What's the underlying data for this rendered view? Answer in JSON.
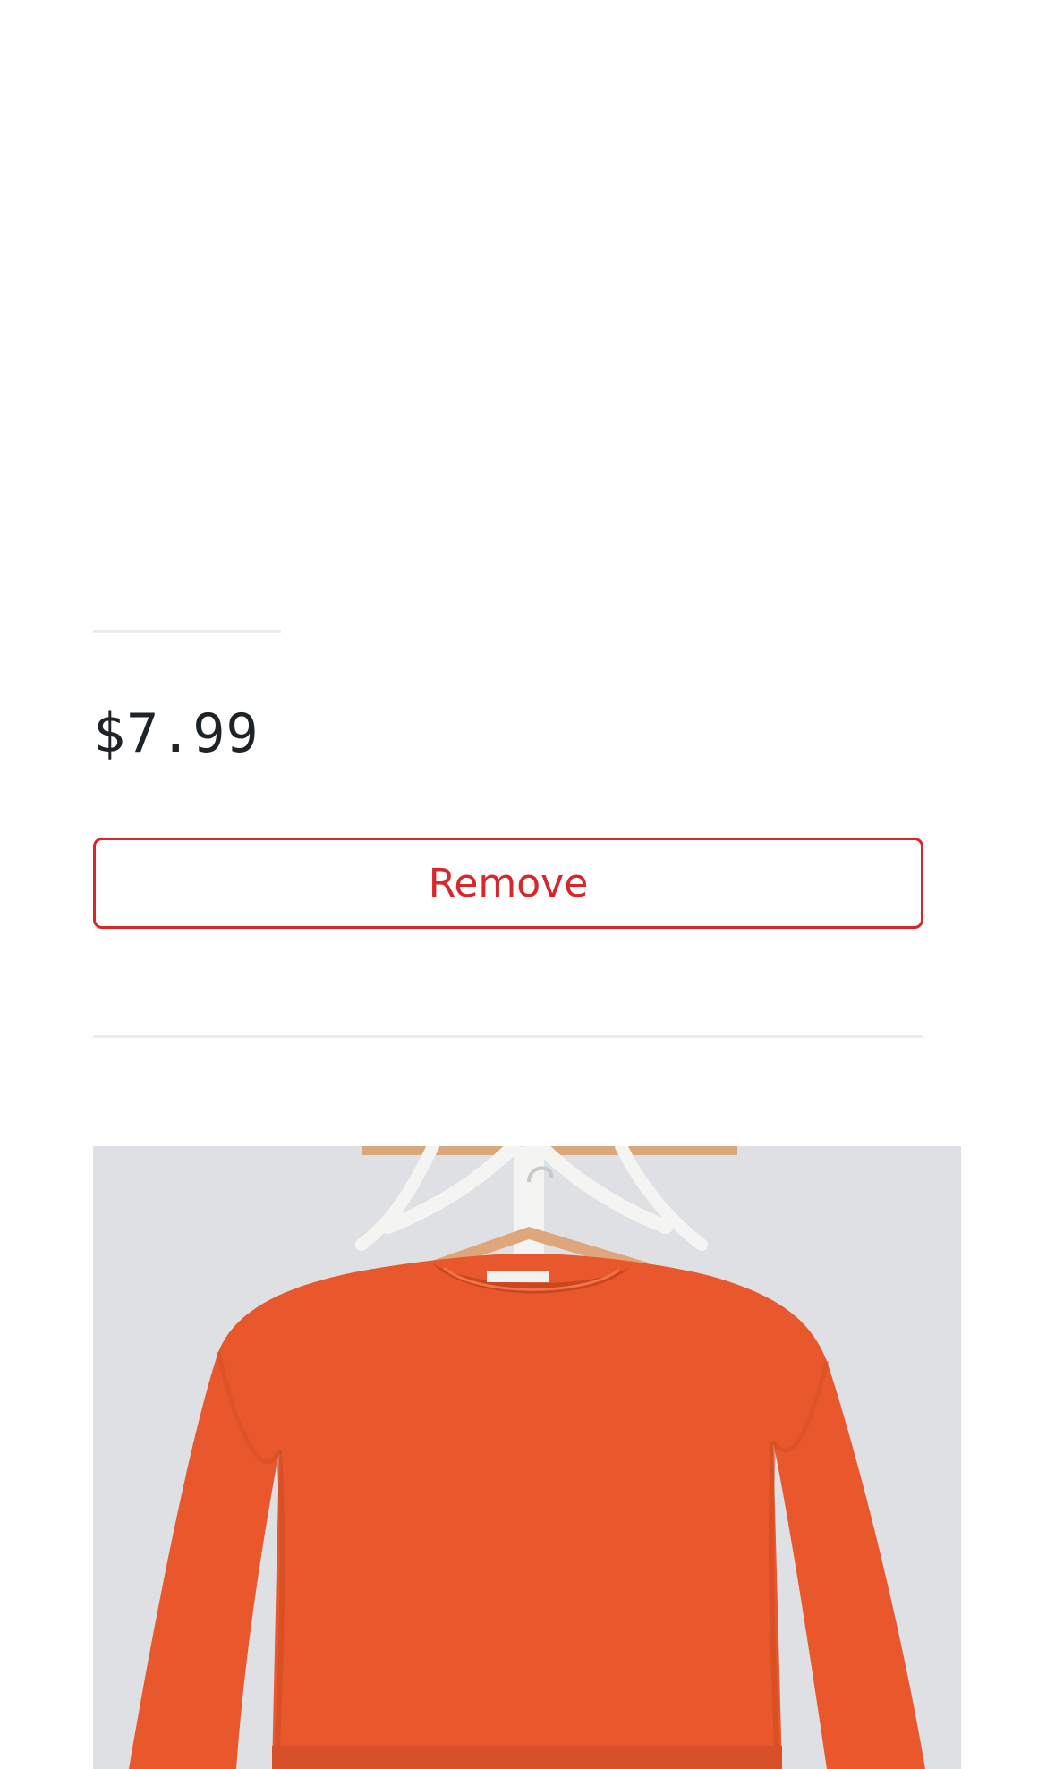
{
  "product": {
    "price": "$7.99",
    "remove_label": "Remove",
    "image_subject": "sweater-photo",
    "colors": {
      "accent": "#d9262b",
      "price_text": "#1d2327",
      "divider": "#ececec",
      "sweater": "#e8582c",
      "image_background": "#dfe0e4"
    }
  }
}
